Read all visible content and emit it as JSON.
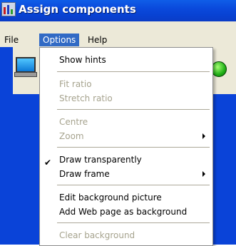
{
  "window": {
    "title": "Assign components"
  },
  "menubar": {
    "file": "File",
    "options": "Options",
    "help": "Help"
  },
  "dropdown": {
    "items": [
      {
        "label": "Show hints",
        "enabled": true
      },
      {
        "label": "Fit ratio",
        "enabled": false
      },
      {
        "label": "Stretch ratio",
        "enabled": false
      },
      {
        "label": "Centre",
        "enabled": false
      },
      {
        "label": "Zoom",
        "enabled": false,
        "submenu": true
      },
      {
        "label": "Draw transparently",
        "enabled": true,
        "checked": true
      },
      {
        "label": "Draw frame",
        "enabled": true,
        "submenu": true
      },
      {
        "label": "Edit background picture",
        "enabled": true
      },
      {
        "label": "Add Web page as background",
        "enabled": true
      },
      {
        "label": "Clear background",
        "enabled": false
      }
    ],
    "check_glyph": "✔"
  },
  "colors": {
    "titlebar": "#0a49dc",
    "menu_highlight": "#316ac5",
    "disabled_text": "#a6a38e",
    "status_led": "#20b017"
  }
}
